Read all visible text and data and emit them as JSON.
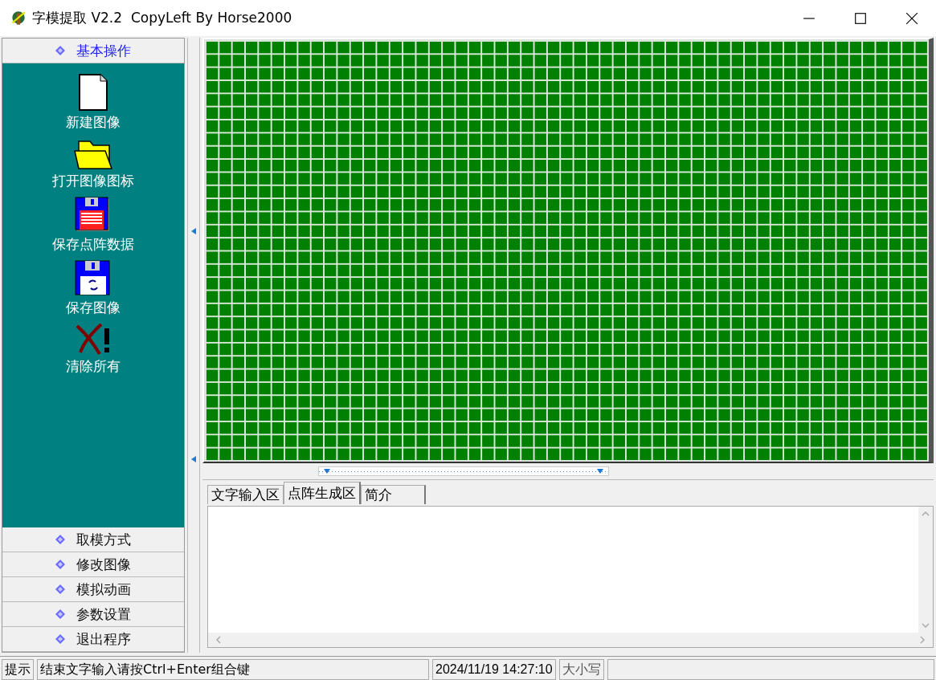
{
  "window": {
    "title": "字模提取 V2.2  CopyLeft By Horse2000"
  },
  "sidebar": {
    "groups": [
      {
        "label": "基本操作",
        "selected": true,
        "tools": [
          {
            "kind": "new",
            "label": "新建图像"
          },
          {
            "kind": "open",
            "label": "打开图像图标"
          },
          {
            "kind": "save_data",
            "label": "保存点阵数据"
          },
          {
            "kind": "save_image",
            "label": "保存图像"
          },
          {
            "kind": "clear",
            "label": "清除所有"
          }
        ]
      },
      {
        "label": "取模方式",
        "selected": false
      },
      {
        "label": "修改图像",
        "selected": false
      },
      {
        "label": "模拟动画",
        "selected": false
      },
      {
        "label": "参数设置",
        "selected": false
      },
      {
        "label": "退出程序",
        "selected": false
      }
    ]
  },
  "tabs": [
    {
      "label": "文字输入区",
      "selected": false
    },
    {
      "label": "点阵生成区",
      "selected": true
    },
    {
      "label": "简介",
      "selected": false
    }
  ],
  "status_bar": {
    "hint_label": "提示",
    "message": "结束文字输入请按Ctrl+Enter组合键",
    "datetime": "2024/11/19 14:27:10",
    "caps": "大小写"
  }
}
